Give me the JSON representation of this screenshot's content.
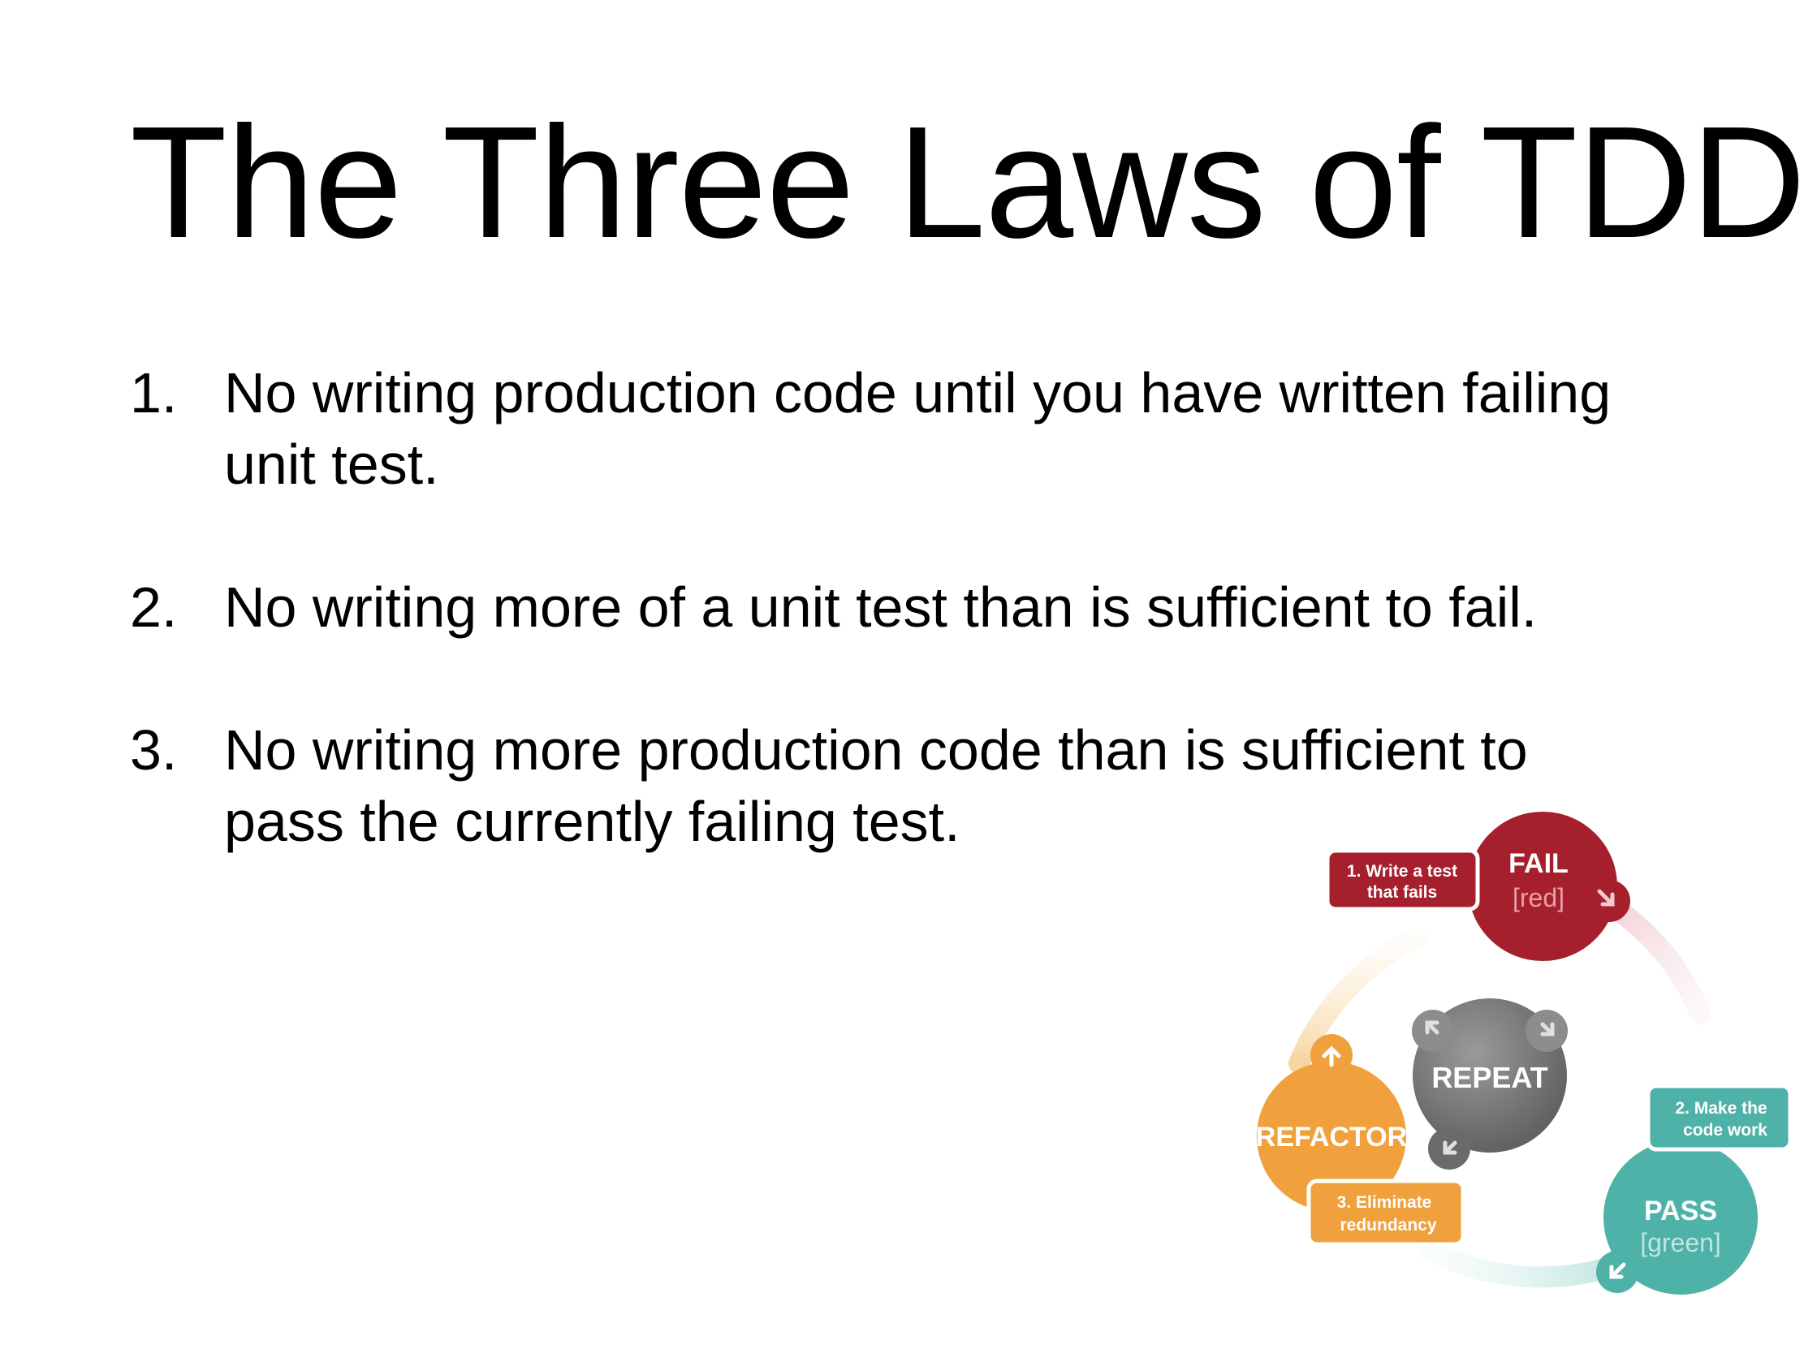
{
  "title": "The Three Laws of TDD",
  "laws": [
    {
      "number": "1.",
      "text": "No writing production code until you have written failing unit test."
    },
    {
      "number": "2.",
      "text": "No writing more of a unit test than is sufficient to fail."
    },
    {
      "number": "3.",
      "text": "No writing more production code than is sufficient to pass the currently failing test."
    }
  ],
  "cycle": {
    "fail": {
      "label": "FAIL",
      "sublabel": "[red]",
      "color": "#a51f2d",
      "step_line1": "1. Write a test",
      "step_line2": "that fails"
    },
    "pass": {
      "label": "PASS",
      "sublabel": "[green]",
      "color": "#4fb2a8",
      "step_line1": "2. Make the",
      "step_line2": "code work"
    },
    "refactor": {
      "label": "REFACTOR",
      "color": "#f0a03c",
      "step_line1": "3. Eliminate",
      "step_line2": "redundancy"
    },
    "repeat": {
      "label": "REPEAT",
      "color": "#777777"
    },
    "icons": [
      "arrow-down-right-icon",
      "arrow-down-left-icon",
      "arrow-up-icon",
      "arrow-cycle-icon"
    ]
  }
}
